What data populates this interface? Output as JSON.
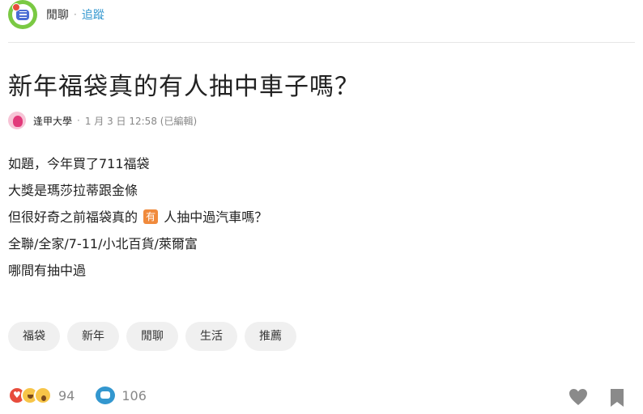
{
  "header": {
    "forum_name": "閒聊",
    "separator": "·",
    "follow_label": "追蹤"
  },
  "post": {
    "title": "新年福袋真的有人抽中車子嗎？",
    "author_school": "逢甲大學",
    "meta_separator": "·",
    "timestamp": "1 月 3 日 12:58 (已編輯)",
    "content_lines": [
      "如題，今年買了711福袋",
      "大獎是瑪莎拉蒂跟金條",
      "但很好奇之前福袋真的",
      "人抽中過汽車嗎？",
      "全聯/全家/7-11/小北百貨/萊爾富",
      "哪間有抽中過"
    ],
    "inline_emoji_text": "有"
  },
  "tags": [
    "福袋",
    "新年",
    "閒聊",
    "生活",
    "推薦"
  ],
  "footer": {
    "reaction_count": "94",
    "comment_count": "106"
  },
  "colors": {
    "follow_link": "#3397cf",
    "forum_icon_bg": "#7ac943",
    "tag_bg": "#f0f0f0",
    "comment_icon": "#3397cf",
    "heart_reaction": "#e74c3c"
  }
}
